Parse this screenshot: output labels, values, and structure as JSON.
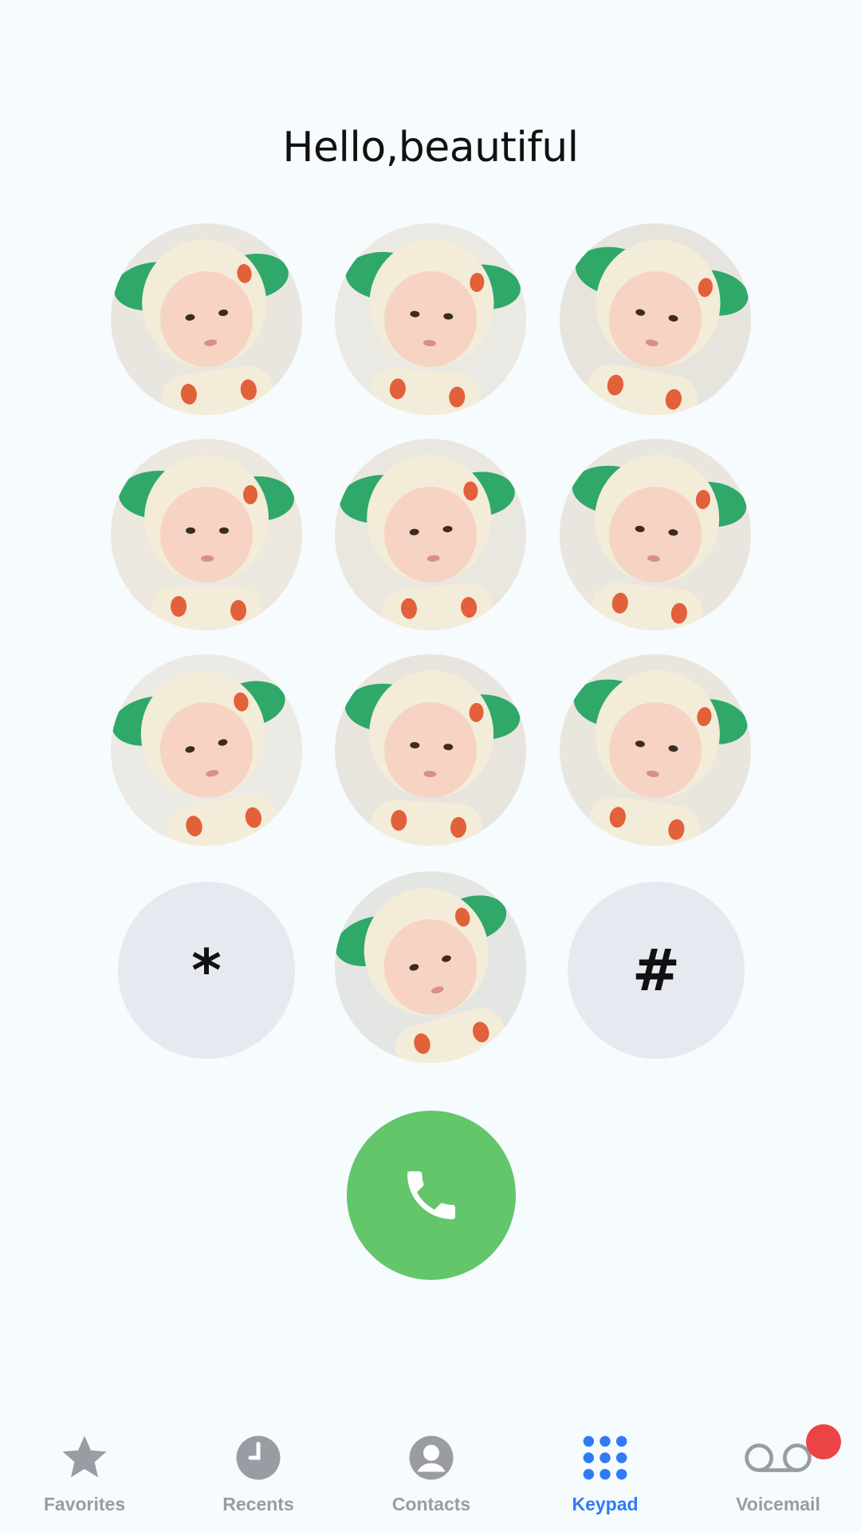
{
  "header": {
    "title": "Hello,beautiful"
  },
  "keypad": {
    "star_label": "*",
    "hash_label": "#"
  },
  "tabbar": {
    "items": [
      {
        "label": "Favorites",
        "icon": "star-icon",
        "active": false
      },
      {
        "label": "Recents",
        "icon": "clock-icon",
        "active": false
      },
      {
        "label": "Contacts",
        "icon": "person-icon",
        "active": false
      },
      {
        "label": "Keypad",
        "icon": "keypad-grid-icon",
        "active": true
      },
      {
        "label": "Voicemail",
        "icon": "voicemail-icon",
        "active": false
      }
    ]
  },
  "colors": {
    "background": "#f6fbfd",
    "call_green": "#63c66a",
    "active_blue": "#2f7bf6",
    "inactive_gray": "#9a9ca3",
    "badge_red": "#ec4444",
    "symbol_key_bg": "#e7e9f1"
  }
}
